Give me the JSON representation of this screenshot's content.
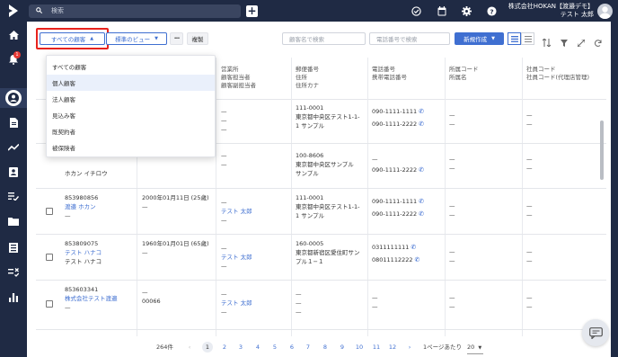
{
  "search": {
    "placeholder": "検索"
  },
  "account": {
    "company": "株式会社HOKAN【渡邉デモ】",
    "user": "テスト 太郎"
  },
  "notifications": {
    "count": "1"
  },
  "toolbar": {
    "view_filter_label": "すべての顧客",
    "standard_view_label": "標準のビュー",
    "more_label": "•••",
    "copy_label": "複製",
    "name_search_placeholder": "顧客名で検索",
    "phone_search_placeholder": "電話番号で検索",
    "new_button_label": "新規作成"
  },
  "columns": [
    {
      "line1": "営業所",
      "line2": "顧客担当者",
      "line3": "顧客副担当者"
    },
    {
      "line1": "郵便番号",
      "line2": "住所",
      "line3": "住所カナ"
    },
    {
      "line1": "電話番号",
      "line2": "携帯電話番号",
      "line3": ""
    },
    {
      "line1": "所属コード",
      "line2": "所属名",
      "line3": ""
    },
    {
      "line1": "社員コード",
      "line2": "社員コード(代理店管理)",
      "line3": ""
    }
  ],
  "dropdown": {
    "items": [
      "すべての顧客",
      "個人顧客",
      "法人顧客",
      "見込み客",
      "既契約者",
      "被保険者"
    ],
    "selected": "個人顧客"
  },
  "rows": [
    {
      "id": "",
      "name": "",
      "name2": "",
      "birth": "",
      "birth2": "",
      "office": "—",
      "owner": "—",
      "sub": "—",
      "zip": "111-0001",
      "addr1": "東京都中央区テスト1-1-",
      "addr2": "1 サンプル",
      "tel": "090-1111-1111",
      "mobile": "090-1111-2222",
      "org": "—",
      "org2": "—",
      "emp": "—",
      "emp2": "—"
    },
    {
      "id": "",
      "name": "",
      "name2": "ホカン イチロウ",
      "birth": "",
      "birth2": "",
      "office": "—",
      "owner": "—",
      "sub": "",
      "zip": "100-8606",
      "addr1": "東京都中央区サンプル",
      "addr2": "サンプル",
      "tel": "—",
      "mobile": "090-1111-2222",
      "org": "—",
      "org2": "—",
      "emp": "—",
      "emp2": "—"
    },
    {
      "id": "853980856",
      "name": "渡邉 ホカン",
      "name2": "—",
      "birth": "2000年01月11日 (25歳)",
      "birth2": "—",
      "office": "—",
      "owner": "テスト 太郎",
      "sub": "—",
      "zip": "111-0001",
      "addr1": "東京都中央区テスト1-1-",
      "addr2": "1 サンプル",
      "tel": "090-1111-1111",
      "mobile": "090-1111-2222",
      "org": "—",
      "org2": "—",
      "emp": "—",
      "emp2": "—"
    },
    {
      "id": "853809075",
      "name": "テスト ハナコ",
      "name2": "テスト ハナコ",
      "birth": "1960年01月01日 (65歳)",
      "birth2": "—",
      "office": "—",
      "owner": "テスト 太郎",
      "sub": "—",
      "zip": "160-0005",
      "addr1": "東京都新宿区愛住町サン",
      "addr2": "プル１−１",
      "tel": "0311111111",
      "mobile": "08011112222",
      "org": "—",
      "org2": "—",
      "emp": "—",
      "emp2": "—"
    },
    {
      "id": "853603341",
      "name": "株式会社テスト渡邉",
      "name2": "—",
      "birth": "—",
      "birth2": "00066",
      "office": "—",
      "owner": "テスト 太郎",
      "sub": "—",
      "zip": "—",
      "addr1": "—",
      "addr2": "—",
      "tel": "—",
      "mobile": "—",
      "org": "—",
      "org2": "—",
      "emp": "—",
      "emp2": "—"
    }
  ],
  "pagination": {
    "total": "264件",
    "pages": [
      "1",
      "2",
      "3",
      "4",
      "5",
      "6",
      "7",
      "8",
      "9",
      "10",
      "11",
      "12"
    ],
    "current": "1",
    "per_page_label": "1ページあたり",
    "per_page_value": "20"
  },
  "colors": {
    "nav_bg": "#1f2a44",
    "accent": "#3f6fd1",
    "highlight": "#e8231d"
  }
}
